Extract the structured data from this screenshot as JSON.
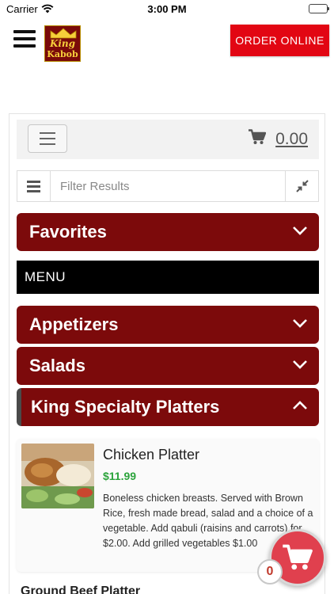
{
  "status_bar": {
    "carrier": "Carrier",
    "time": "3:00 PM"
  },
  "header": {
    "logo_line1": "King",
    "logo_line2": "Kabob",
    "order_online_label": "ORDER ONLINE"
  },
  "cart": {
    "total": "0.00",
    "count": "0"
  },
  "filter": {
    "placeholder": "Filter Results",
    "value": ""
  },
  "menu_label": "MENU",
  "categories": [
    {
      "label": "Favorites",
      "expanded": false
    },
    {
      "label": "Appetizers",
      "expanded": false
    },
    {
      "label": "Salads",
      "expanded": false
    },
    {
      "label": "King Specialty Platters",
      "expanded": true
    }
  ],
  "items": [
    {
      "name": "Chicken Platter",
      "price": "$11.99",
      "description": "Boneless chicken breasts. Served with Brown Rice, fresh made bread, salad and a choice of a vegetable. Add qabuli (raisins and carrots) for $2.00. Add grilled vegetables $1.00"
    },
    {
      "name": "Ground Beef Platter"
    }
  ],
  "colors": {
    "category_bg": "#7c0a0b",
    "order_button": "#e20613",
    "price": "#2ba33b",
    "fab": "#e0404e"
  },
  "icons": [
    "hamburger-icon",
    "cart-icon",
    "list-icon",
    "compress-icon",
    "chevron-down-icon",
    "chevron-up-icon",
    "crown-icon"
  ]
}
